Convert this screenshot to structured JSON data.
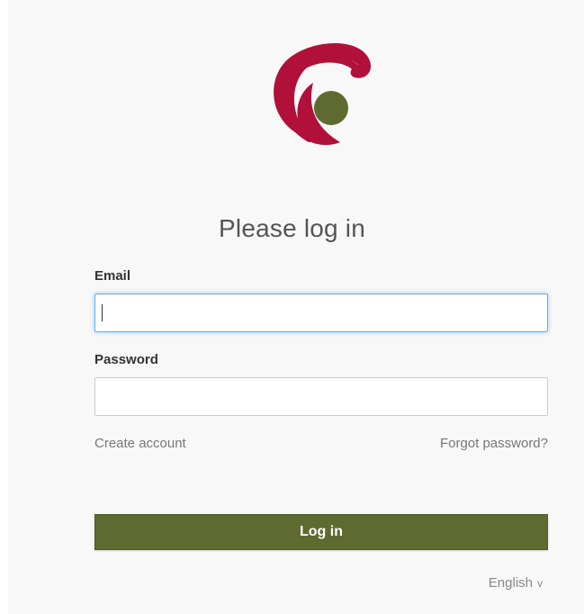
{
  "app": {
    "logo_name": "swirl-logo",
    "brand_colors": {
      "crimson": "#b0103a",
      "olive": "#5e6a2f"
    }
  },
  "form": {
    "title": "Please log in",
    "email_label": "Email",
    "email_value": "",
    "password_label": "Password",
    "password_value": "",
    "create_account": "Create account",
    "forgot_password": "Forgot password?",
    "submit_label": "Log in"
  },
  "footer": {
    "language": "English",
    "language_chevron": "v"
  }
}
